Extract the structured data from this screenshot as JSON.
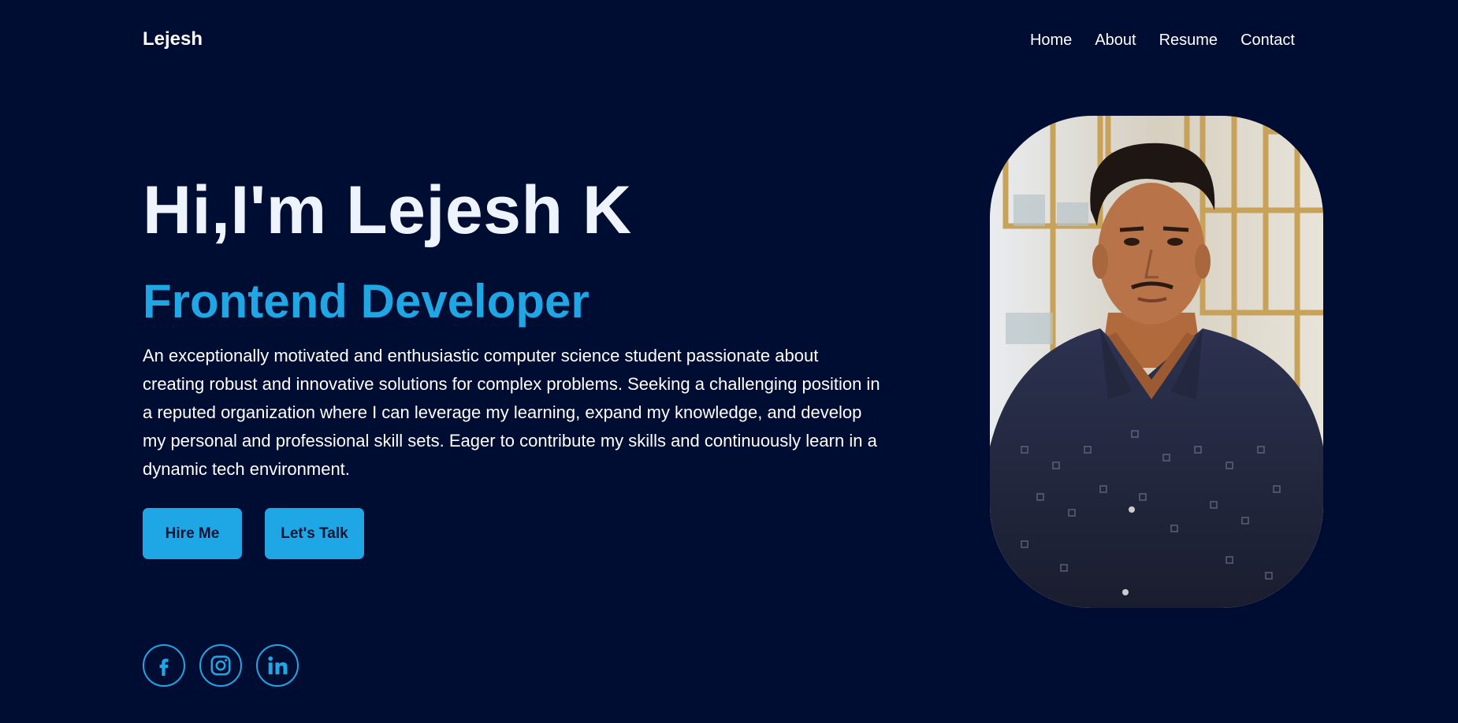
{
  "header": {
    "logo": "Lejesh",
    "nav": [
      "Home",
      "About",
      "Resume",
      "Contact"
    ]
  },
  "hero": {
    "title": "Hi,I'm Lejesh K",
    "role": "Frontend Developer",
    "description": "An exceptionally motivated and enthusiastic computer science student passionate about creating robust and innovative solutions for complex problems. Seeking a challenging position in a reputed organization where I can leverage my learning, expand my knowledge, and develop my personal and professional skill sets. Eager to contribute my skills and continuously learn in a dynamic tech environment.",
    "buttons": {
      "hire": "Hire Me",
      "talk": "Let's Talk"
    }
  },
  "social": [
    {
      "icon": "facebook-icon"
    },
    {
      "icon": "instagram-icon"
    },
    {
      "icon": "linkedin-icon"
    }
  ],
  "colors": {
    "background": "#000d33",
    "accent": "#1ea7e4",
    "title": "#eef4ff"
  }
}
